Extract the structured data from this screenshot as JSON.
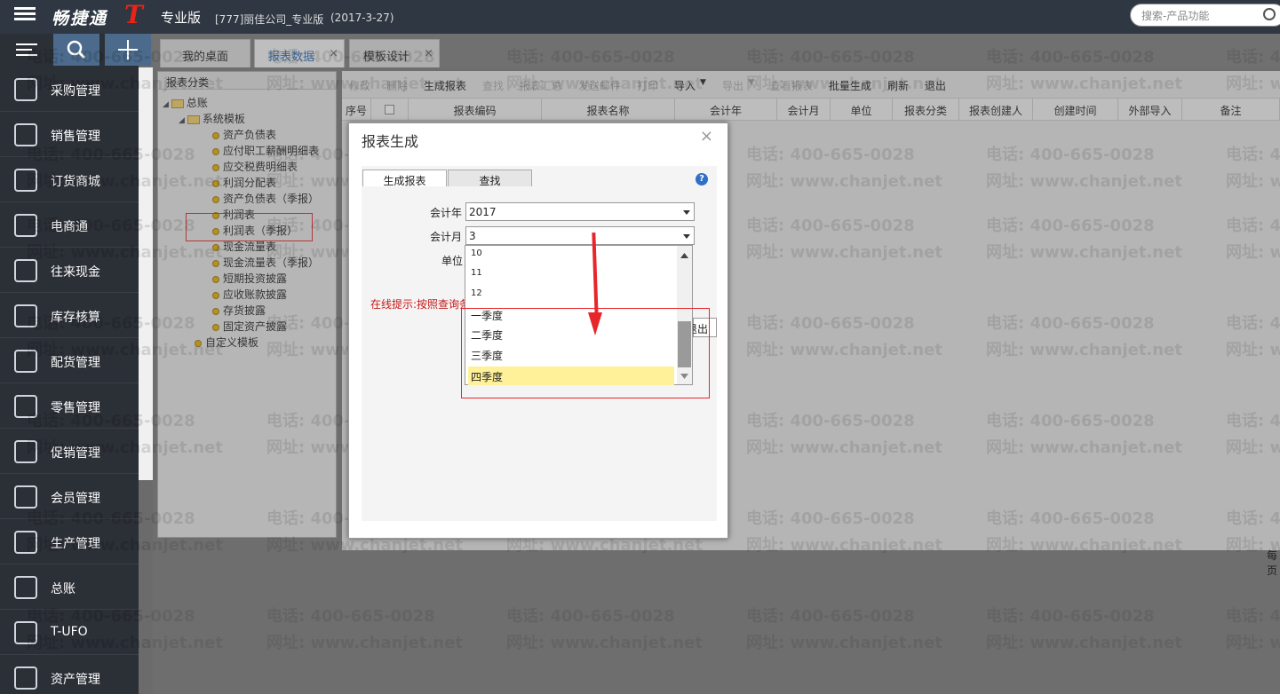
{
  "topbar": {
    "logo": "畅捷通",
    "logo_mark": "T",
    "edition": "专业版",
    "company": "[777]丽佳公司_专业版",
    "date": "(2017-3-27)",
    "search_placeholder": "搜索-产品功能"
  },
  "sidebar": {
    "items": [
      {
        "label": "采购管理",
        "icon": "cart-icon"
      },
      {
        "label": "销售管理",
        "icon": "chart-icon"
      },
      {
        "label": "订货商城",
        "icon": "shopping-cart-icon"
      },
      {
        "label": "电商通",
        "icon": "ecommerce-icon"
      },
      {
        "label": "往来现金",
        "icon": "dollar-icon"
      },
      {
        "label": "库存核算",
        "icon": "warehouse-icon"
      },
      {
        "label": "配货管理",
        "icon": "truck-icon"
      },
      {
        "label": "零售管理",
        "icon": "retail-icon"
      },
      {
        "label": "促销管理",
        "icon": "megaphone-icon"
      },
      {
        "label": "会员管理",
        "icon": "tie-icon"
      },
      {
        "label": "生产管理",
        "icon": "gears-icon"
      },
      {
        "label": "总账",
        "icon": "ledger-icon"
      },
      {
        "label": "T-UFO",
        "icon": "ufo-icon"
      },
      {
        "label": "资产管理",
        "icon": "asset-icon"
      }
    ]
  },
  "tabs": [
    {
      "label": "我的桌面"
    },
    {
      "label": "报表数据",
      "close": "×"
    },
    {
      "label": "模板设计",
      "close": "×"
    }
  ],
  "tree": {
    "title": "报表分类",
    "root": "总账",
    "system": "系统模板",
    "reports": [
      "资产负债表",
      "应付职工薪酬明细表",
      "应交税费明细表",
      "利润分配表",
      "资产负债表（季报）",
      "利润表",
      "利润表（季报）",
      "现金流量表",
      "现金流量表（季报）",
      "短期投资披露",
      "应收账款披露",
      "存货披露",
      "固定资产披露"
    ],
    "custom": "自定义模板"
  },
  "toolbar": {
    "items": [
      "修改",
      "删除",
      "生成报表",
      "查找",
      "报表汇总",
      "发送邮件",
      "打印",
      "导入",
      "导出",
      "查看报表",
      "批量生成",
      "刷新",
      "退出"
    ]
  },
  "grid": {
    "columns": [
      "序号",
      "报表编码",
      "报表名称",
      "会计年",
      "会计月",
      "单位",
      "报表分类",
      "报表创建人",
      "创建时间",
      "外部导入",
      "备注"
    ]
  },
  "watermark": {
    "phone": "电话: 400-665-0028",
    "site": "网址: www.chanjet.net"
  },
  "dialog": {
    "title": "报表生成",
    "close": "×",
    "tabs": [
      "生成报表",
      "查找"
    ],
    "help": "?",
    "year_label": "会计年",
    "year_value": "2017",
    "month_label": "会计月",
    "month_value": "3",
    "unit_label": "单位",
    "hint": "在线提示:按照查询条",
    "exit_label": "退出",
    "options": [
      "10",
      "11",
      "12",
      "一季度",
      "二季度",
      "三季度",
      "四季度"
    ],
    "selected_option": "四季度"
  },
  "page_right_fragment": "每页"
}
